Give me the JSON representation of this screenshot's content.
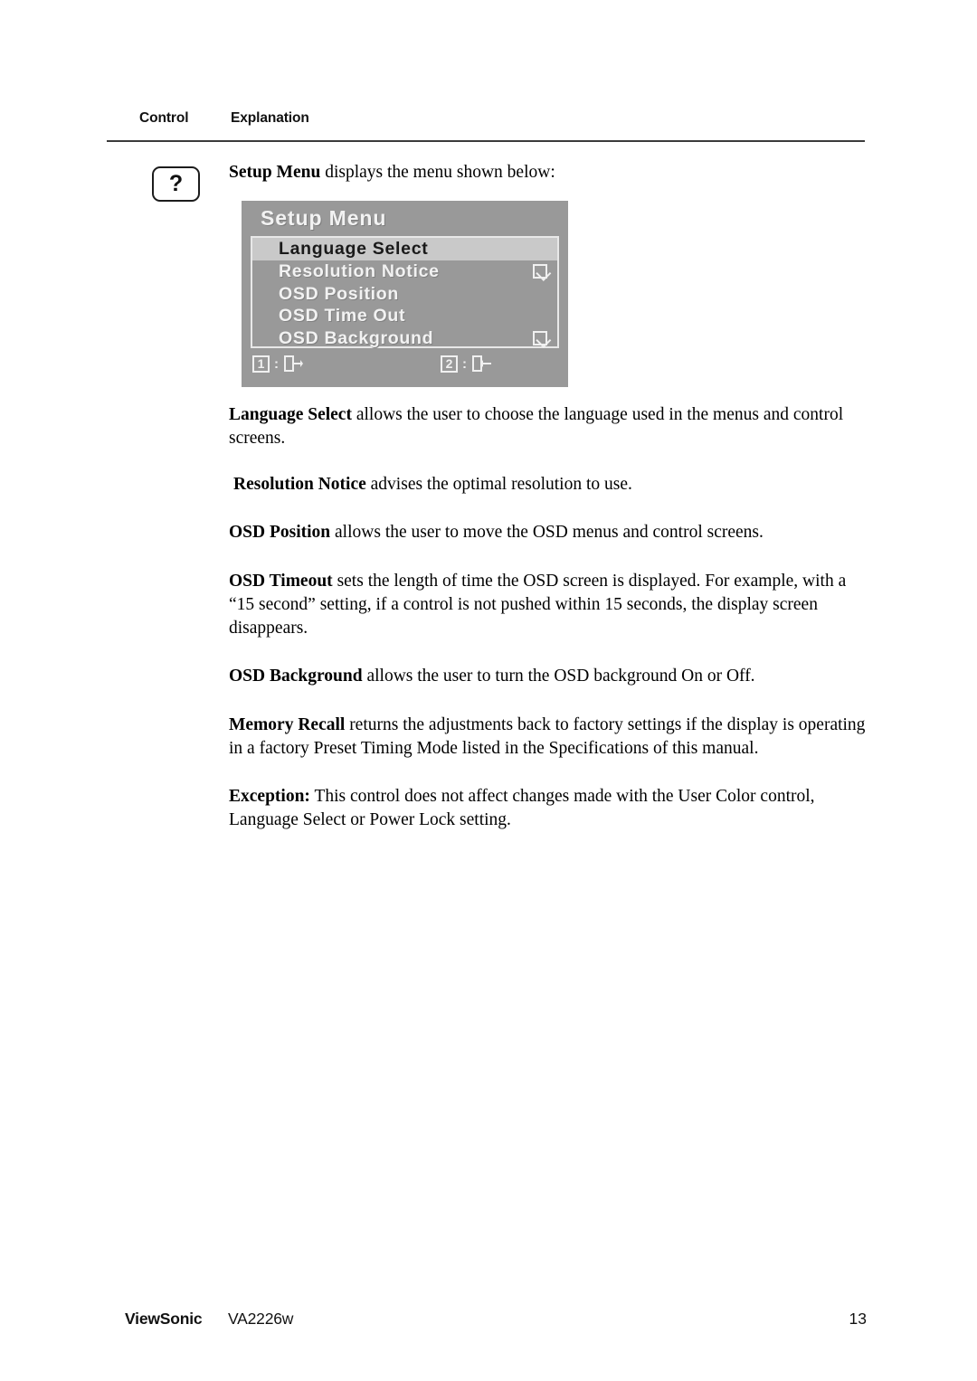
{
  "header": {
    "col_control": "Control",
    "col_explanation": "Explanation"
  },
  "help_icon": {
    "glyph": "?",
    "name": "question-mark-icon"
  },
  "paragraphs": {
    "intro": {
      "bold": "Setup Menu",
      "rest": " displays the menu shown below:"
    },
    "language_select": {
      "bold": "Language Select",
      "rest": " allows the user to choose the language used in the menus and control screens."
    },
    "resolution_notice": {
      "bold": "Resolution Notice",
      "rest": " advises the optimal resolution to use."
    },
    "osd_position": {
      "bold": "OSD Position",
      "rest": " allows the user to move the OSD menus and control screens."
    },
    "osd_timeout": {
      "bold": "OSD Timeout",
      "rest": " sets the length of time the OSD screen is displayed. For example, with a “15 second” setting, if a control is not pushed within 15 seconds, the display screen disappears."
    },
    "osd_background": {
      "bold": "OSD Background",
      "rest": " allows the user to turn the OSD background On or Off."
    },
    "memory_recall": {
      "bold": "Memory Recall",
      "rest": " returns the adjustments back to factory settings if the display is operating in a factory Preset Timing Mode listed in the Specifications of this manual."
    },
    "exception": {
      "bold": "Exception:",
      "rest": " This control does not affect changes made with the User Color control, Language Select or Power Lock setting."
    }
  },
  "osd": {
    "title": "Setup Menu",
    "background_color": "#999999",
    "selected_row_color": "#c9c9c9",
    "text_color": "#f2f2f2",
    "items": [
      {
        "label": "Language Select",
        "selected": true,
        "checkbox": false
      },
      {
        "label": "Resolution Notice",
        "selected": false,
        "checkbox": true
      },
      {
        "label": "OSD Position",
        "selected": false,
        "checkbox": false
      },
      {
        "label": "OSD Time Out",
        "selected": false,
        "checkbox": false
      },
      {
        "label": "OSD Background",
        "selected": false,
        "checkbox": true
      }
    ],
    "footer_keys": [
      {
        "key": "1",
        "colon": ":",
        "icon": "exit-right-arrow-icon"
      },
      {
        "key": "2",
        "colon": ":",
        "icon": "enter-left-arrow-icon"
      }
    ]
  },
  "footer": {
    "brand": "ViewSonic",
    "model": "VA2226w",
    "page_number": "13"
  }
}
